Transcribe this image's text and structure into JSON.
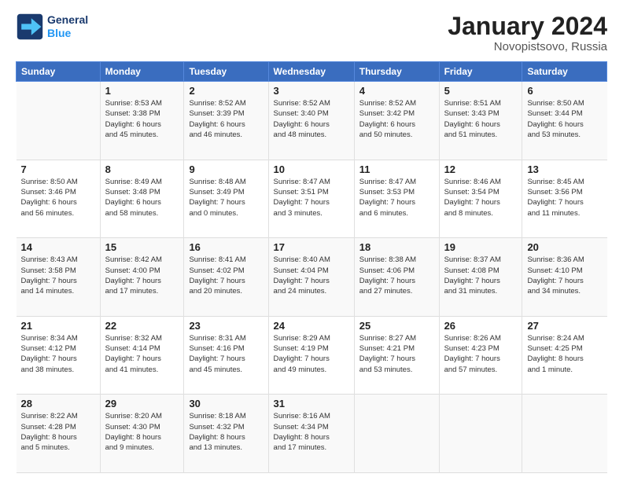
{
  "logo": {
    "line1": "General",
    "line2": "Blue"
  },
  "title": "January 2024",
  "location": "Novopistsovo, Russia",
  "header_days": [
    "Sunday",
    "Monday",
    "Tuesday",
    "Wednesday",
    "Thursday",
    "Friday",
    "Saturday"
  ],
  "weeks": [
    [
      {
        "num": "",
        "info": ""
      },
      {
        "num": "1",
        "info": "Sunrise: 8:53 AM\nSunset: 3:38 PM\nDaylight: 6 hours\nand 45 minutes."
      },
      {
        "num": "2",
        "info": "Sunrise: 8:52 AM\nSunset: 3:39 PM\nDaylight: 6 hours\nand 46 minutes."
      },
      {
        "num": "3",
        "info": "Sunrise: 8:52 AM\nSunset: 3:40 PM\nDaylight: 6 hours\nand 48 minutes."
      },
      {
        "num": "4",
        "info": "Sunrise: 8:52 AM\nSunset: 3:42 PM\nDaylight: 6 hours\nand 50 minutes."
      },
      {
        "num": "5",
        "info": "Sunrise: 8:51 AM\nSunset: 3:43 PM\nDaylight: 6 hours\nand 51 minutes."
      },
      {
        "num": "6",
        "info": "Sunrise: 8:50 AM\nSunset: 3:44 PM\nDaylight: 6 hours\nand 53 minutes."
      }
    ],
    [
      {
        "num": "7",
        "info": "Sunrise: 8:50 AM\nSunset: 3:46 PM\nDaylight: 6 hours\nand 56 minutes."
      },
      {
        "num": "8",
        "info": "Sunrise: 8:49 AM\nSunset: 3:48 PM\nDaylight: 6 hours\nand 58 minutes."
      },
      {
        "num": "9",
        "info": "Sunrise: 8:48 AM\nSunset: 3:49 PM\nDaylight: 7 hours\nand 0 minutes."
      },
      {
        "num": "10",
        "info": "Sunrise: 8:47 AM\nSunset: 3:51 PM\nDaylight: 7 hours\nand 3 minutes."
      },
      {
        "num": "11",
        "info": "Sunrise: 8:47 AM\nSunset: 3:53 PM\nDaylight: 7 hours\nand 6 minutes."
      },
      {
        "num": "12",
        "info": "Sunrise: 8:46 AM\nSunset: 3:54 PM\nDaylight: 7 hours\nand 8 minutes."
      },
      {
        "num": "13",
        "info": "Sunrise: 8:45 AM\nSunset: 3:56 PM\nDaylight: 7 hours\nand 11 minutes."
      }
    ],
    [
      {
        "num": "14",
        "info": "Sunrise: 8:43 AM\nSunset: 3:58 PM\nDaylight: 7 hours\nand 14 minutes."
      },
      {
        "num": "15",
        "info": "Sunrise: 8:42 AM\nSunset: 4:00 PM\nDaylight: 7 hours\nand 17 minutes."
      },
      {
        "num": "16",
        "info": "Sunrise: 8:41 AM\nSunset: 4:02 PM\nDaylight: 7 hours\nand 20 minutes."
      },
      {
        "num": "17",
        "info": "Sunrise: 8:40 AM\nSunset: 4:04 PM\nDaylight: 7 hours\nand 24 minutes."
      },
      {
        "num": "18",
        "info": "Sunrise: 8:38 AM\nSunset: 4:06 PM\nDaylight: 7 hours\nand 27 minutes."
      },
      {
        "num": "19",
        "info": "Sunrise: 8:37 AM\nSunset: 4:08 PM\nDaylight: 7 hours\nand 31 minutes."
      },
      {
        "num": "20",
        "info": "Sunrise: 8:36 AM\nSunset: 4:10 PM\nDaylight: 7 hours\nand 34 minutes."
      }
    ],
    [
      {
        "num": "21",
        "info": "Sunrise: 8:34 AM\nSunset: 4:12 PM\nDaylight: 7 hours\nand 38 minutes."
      },
      {
        "num": "22",
        "info": "Sunrise: 8:32 AM\nSunset: 4:14 PM\nDaylight: 7 hours\nand 41 minutes."
      },
      {
        "num": "23",
        "info": "Sunrise: 8:31 AM\nSunset: 4:16 PM\nDaylight: 7 hours\nand 45 minutes."
      },
      {
        "num": "24",
        "info": "Sunrise: 8:29 AM\nSunset: 4:19 PM\nDaylight: 7 hours\nand 49 minutes."
      },
      {
        "num": "25",
        "info": "Sunrise: 8:27 AM\nSunset: 4:21 PM\nDaylight: 7 hours\nand 53 minutes."
      },
      {
        "num": "26",
        "info": "Sunrise: 8:26 AM\nSunset: 4:23 PM\nDaylight: 7 hours\nand 57 minutes."
      },
      {
        "num": "27",
        "info": "Sunrise: 8:24 AM\nSunset: 4:25 PM\nDaylight: 8 hours\nand 1 minute."
      }
    ],
    [
      {
        "num": "28",
        "info": "Sunrise: 8:22 AM\nSunset: 4:28 PM\nDaylight: 8 hours\nand 5 minutes."
      },
      {
        "num": "29",
        "info": "Sunrise: 8:20 AM\nSunset: 4:30 PM\nDaylight: 8 hours\nand 9 minutes."
      },
      {
        "num": "30",
        "info": "Sunrise: 8:18 AM\nSunset: 4:32 PM\nDaylight: 8 hours\nand 13 minutes."
      },
      {
        "num": "31",
        "info": "Sunrise: 8:16 AM\nSunset: 4:34 PM\nDaylight: 8 hours\nand 17 minutes."
      },
      {
        "num": "",
        "info": ""
      },
      {
        "num": "",
        "info": ""
      },
      {
        "num": "",
        "info": ""
      }
    ]
  ]
}
